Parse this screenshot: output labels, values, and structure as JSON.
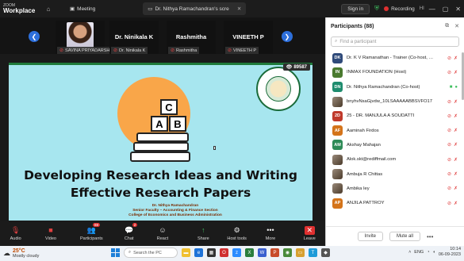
{
  "app": {
    "brand_line1": "ZOOM",
    "brand_line2": "Workplace",
    "meeting_tab": "Meeting",
    "share_tab": "Dr. Nithya Ramachandran's scre",
    "signout": "Sign in",
    "recording": "Recording",
    "rec_extra": "HI"
  },
  "strip": {
    "tiles": [
      {
        "name": "",
        "label": "SAVINA PRIYADARSHI",
        "muted": true,
        "photo": true
      },
      {
        "name": "Dr. Ninikala K",
        "label": "Dr. Ninikala K",
        "muted": true,
        "photo": false
      },
      {
        "name": "Rashmitha",
        "label": "Rashmitha",
        "muted": true,
        "photo": false
      },
      {
        "name": "VINEETH P",
        "label": "VINEETH P",
        "muted": true,
        "photo": false
      }
    ]
  },
  "slide": {
    "viewer_count": "89587",
    "title_line1": "Developing Research Ideas and Writing",
    "title_line2": "Effective Research Papers",
    "author_line1": "Dr. Nithya Ramachandran",
    "author_line2": "Senior Faculty – Accounting & Finance Section",
    "author_line3": "College of Economics and Business Administration",
    "blocks": [
      "C",
      "A",
      "B"
    ]
  },
  "toolbar": {
    "items": [
      {
        "label": "Audio",
        "icon": "mic-muted-icon",
        "glyph": "🎙",
        "off": true
      },
      {
        "label": "Video",
        "icon": "video-off-icon",
        "glyph": "■",
        "off": true
      },
      {
        "label": "Participants",
        "icon": "participants-icon",
        "glyph": "👥",
        "badge": "88"
      },
      {
        "label": "Chat",
        "icon": "chat-icon",
        "glyph": "💬",
        "badge": "2"
      },
      {
        "label": "React",
        "icon": "react-icon",
        "glyph": "☺"
      },
      {
        "label": "Share",
        "icon": "share-icon",
        "glyph": "↑",
        "share": true
      },
      {
        "label": "Host tools",
        "icon": "host-tools-icon",
        "glyph": "⚙"
      },
      {
        "label": "More",
        "icon": "more-icon",
        "glyph": "•••"
      },
      {
        "label": "Leave",
        "icon": "leave-icon",
        "glyph": "✕",
        "leave": true
      }
    ]
  },
  "panel": {
    "title": "Participants (88)",
    "search_placeholder": "Find a participant",
    "participants": [
      {
        "initials": "DK",
        "name": "Dr. K V Ramanathan - Trainer (Co-host, me)",
        "color": "#2f4a7a",
        "video_off": true,
        "mic": "muted"
      },
      {
        "initials": "IN",
        "name": "INMAX FOUNDATION (Host)",
        "color": "#4a7a2f",
        "video_off": true,
        "mic": "muted"
      },
      {
        "initials": "DN",
        "name": "Dr. Nithya Ramachandran (Co-host)",
        "color": "#1e8c6e",
        "video_off": false,
        "mic": "on"
      },
      {
        "initials": "",
        "name": "bnyhvNsaGjvdw_10LSAAAAABBSVFO17",
        "color": "#888888",
        "video_off": true,
        "mic": "muted",
        "photo": true
      },
      {
        "initials": "2D",
        "name": "25 - DR. MANJULA A SOUDATTI",
        "color": "#c0392b",
        "video_off": true,
        "mic": "muted"
      },
      {
        "initials": "AF",
        "name": "Aaminah Firdos",
        "color": "#d4741a",
        "video_off": true,
        "mic": "muted"
      },
      {
        "initials": "AM",
        "name": "Akshay Mahajan",
        "color": "#2e8b57",
        "video_off": true,
        "mic": "muted"
      },
      {
        "initials": "",
        "name": "Alok.skt@rediffmail.com",
        "color": "#777777",
        "video_off": true,
        "mic": "muted",
        "photo": true
      },
      {
        "initials": "",
        "name": "Ambuja R Chittas",
        "color": "#777777",
        "video_off": true,
        "mic": "muted",
        "photo": true
      },
      {
        "initials": "",
        "name": "Ambika Iey",
        "color": "#777777",
        "video_off": true,
        "mic": "muted",
        "photo": true
      },
      {
        "initials": "AP",
        "name": "ANJILA PATTROY",
        "color": "#d4741a",
        "video_off": true,
        "mic": "muted"
      }
    ],
    "invite": "Invite",
    "mute_all": "Mute all"
  },
  "taskbar": {
    "temp": "25°C",
    "weather": "Mostly cloudy",
    "search": "Search the PC",
    "time": "10:14",
    "date": "06-09-2023",
    "lang": "ENG"
  }
}
